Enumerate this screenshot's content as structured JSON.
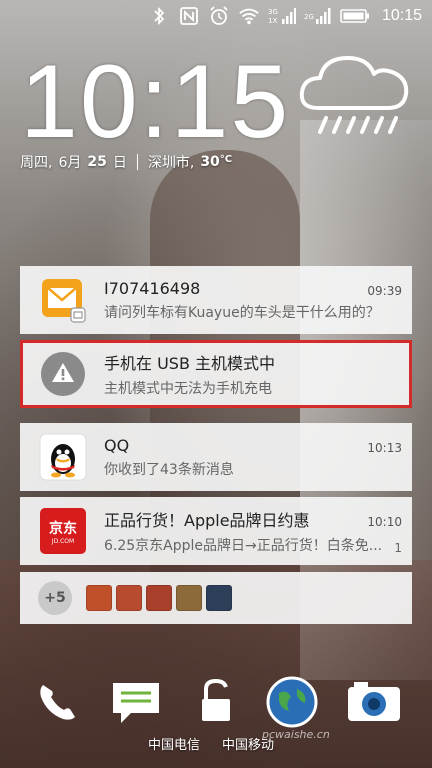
{
  "status_bar": {
    "time": "10:15",
    "icons": [
      "bluetooth-icon",
      "nfc-icon",
      "alarm-icon",
      "wifi-icon",
      "signal-icon",
      "signal-2g-icon",
      "battery-icon"
    ],
    "network_label_1": "3G",
    "network_label_2": "1X",
    "network_label_3": "2G"
  },
  "lockscreen": {
    "clock": "10:15",
    "date_weekday": "周四,",
    "date_month": "6月",
    "date_day": "25",
    "date_day_suffix": "日",
    "city": "深圳市,",
    "temperature": "30",
    "temperature_unit": "°C",
    "weather": "rain-cloud-icon"
  },
  "notifications": [
    {
      "app_icon": "email-icon",
      "title": "I707416498",
      "body": "请问列车标有Kuayue的车头是干什么用的？",
      "time": "09:39"
    },
    {
      "app_icon": "warning-icon",
      "title": "手机在 USB 主机模式中",
      "body": "主机模式中无法为手机充电",
      "time": "",
      "highlight_color": "#d42a2a"
    },
    {
      "app_icon": "qq-icon",
      "title": "QQ",
      "body": "你收到了43条新消息",
      "time": "10:13"
    },
    {
      "app_icon": "jd-icon",
      "app_icon_text": "京东",
      "app_icon_subtext": "JD.COM",
      "title": "正品行货！Apple品牌日约惠",
      "body": "6.25京东Apple品牌日→正品行货！白条免...",
      "time": "10:10",
      "count": "1"
    }
  ],
  "more_notifications": {
    "badge": "+5",
    "apps": [
      "taobao-icon",
      "app-icon-2",
      "app-icon-3",
      "app-icon-4",
      "zaker-icon"
    ]
  },
  "dock": {
    "items": [
      "phone-icon",
      "messages-icon",
      "unlock-icon",
      "browser-icon",
      "camera-icon"
    ],
    "carrier_1": "中国电信",
    "carrier_2": "中国移动"
  },
  "watermark": "pcwaishe.cn",
  "colors": {
    "highlight": "#d42a2a",
    "card_bg": "#f5f5f5",
    "jd_red": "#d71c1e",
    "email_orange": "#f3a21b"
  }
}
